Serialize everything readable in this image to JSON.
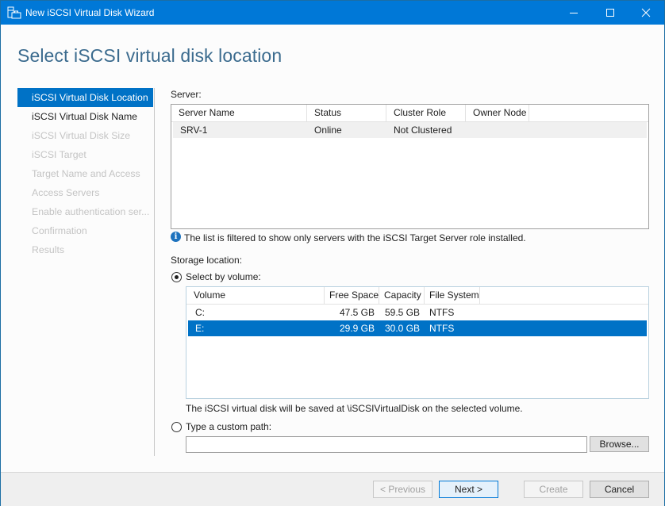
{
  "window": {
    "title": "New iSCSI Virtual Disk Wizard",
    "controls": {
      "minimize": "minimize",
      "maximize": "maximize",
      "close": "close"
    }
  },
  "page_title": "Select iSCSI virtual disk location",
  "nav": {
    "items": [
      {
        "label": "iSCSI Virtual Disk Location",
        "state": "active"
      },
      {
        "label": "iSCSI Virtual Disk Name",
        "state": "enabled"
      },
      {
        "label": "iSCSI Virtual Disk Size",
        "state": "disabled"
      },
      {
        "label": "iSCSI Target",
        "state": "disabled"
      },
      {
        "label": "Target Name and Access",
        "state": "disabled"
      },
      {
        "label": "Access Servers",
        "state": "disabled"
      },
      {
        "label": "Enable authentication ser...",
        "state": "disabled"
      },
      {
        "label": "Confirmation",
        "state": "disabled"
      },
      {
        "label": "Results",
        "state": "disabled"
      }
    ]
  },
  "server": {
    "label": "Server:",
    "columns": [
      "Server Name",
      "Status",
      "Cluster Role",
      "Owner Node"
    ],
    "rows": [
      {
        "server_name": "SRV-1",
        "status": "Online",
        "cluster_role": "Not Clustered",
        "owner_node": ""
      }
    ],
    "info_text": "The list is filtered to show only servers with the iSCSI Target Server role installed."
  },
  "storage": {
    "label": "Storage location:",
    "select_by_volume": {
      "label": "Select by volume:",
      "checked": true
    },
    "volume_columns": [
      "Volume",
      "Free Space",
      "Capacity",
      "File System"
    ],
    "volumes": [
      {
        "volume": "C:",
        "free_space": "47.5 GB",
        "capacity": "59.5 GB",
        "file_system": "NTFS",
        "selected": false
      },
      {
        "volume": "E:",
        "free_space": "29.9 GB",
        "capacity": "30.0 GB",
        "file_system": "NTFS",
        "selected": true
      }
    ],
    "save_note": "The iSCSI virtual disk will be saved at \\iSCSIVirtualDisk on the selected volume.",
    "custom_path": {
      "label": "Type a custom path:",
      "checked": false,
      "value": ""
    },
    "browse_label": "Browse..."
  },
  "footer": {
    "previous": "< Previous",
    "next": "Next >",
    "create": "Create",
    "cancel": "Cancel"
  }
}
